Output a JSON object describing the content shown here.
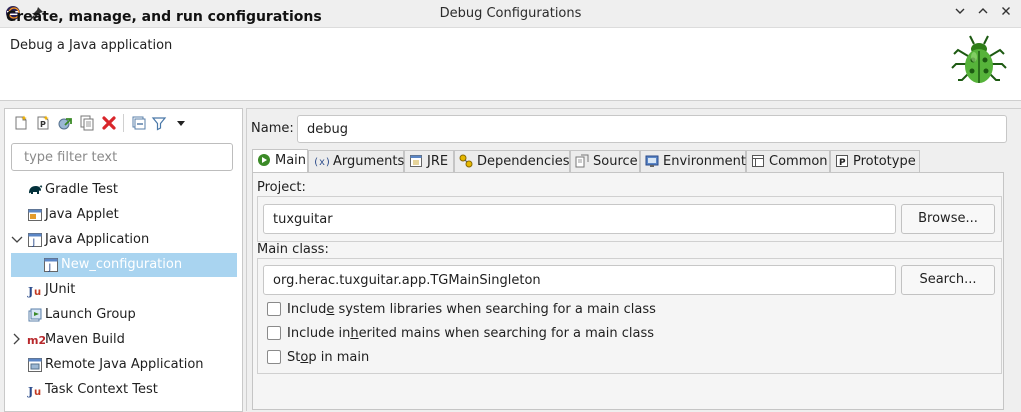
{
  "window": {
    "title": "Debug Configurations",
    "icons": [
      "eclipse-logo-icon",
      "pin-icon"
    ],
    "controls": [
      "minimize-icon",
      "maximize-icon",
      "close-icon"
    ]
  },
  "header": {
    "title": "Create, manage, and run configurations",
    "subtitle": "Debug a Java application",
    "logo": "debug-bug-icon"
  },
  "left_toolbar": {
    "icons": [
      "new-configuration-icon",
      "new-prototype-icon",
      "export-icon",
      "duplicate-icon",
      "delete-icon",
      "collapse-all-icon",
      "filter-icon",
      "view-menu-icon"
    ]
  },
  "filter": {
    "placeholder": "type filter text",
    "value": ""
  },
  "tree": {
    "items": [
      {
        "label": "Gradle Test",
        "icon": "gradle-icon"
      },
      {
        "label": "Java Applet",
        "icon": "java-applet-icon"
      },
      {
        "label": "Java Application",
        "icon": "java-application-icon",
        "expanded": true
      },
      {
        "label": "New_configuration",
        "icon": "java-application-icon",
        "selected": true
      },
      {
        "label": "JUnit",
        "icon": "junit-icon"
      },
      {
        "label": "Launch Group",
        "icon": "launch-group-icon"
      },
      {
        "label": "Maven Build",
        "icon": "maven-icon",
        "expanded": false
      },
      {
        "label": "Remote Java Application",
        "icon": "remote-java-icon"
      },
      {
        "label": "Task Context Test",
        "icon": "junit-icon"
      }
    ]
  },
  "config": {
    "name_label": "Name:",
    "name_value": "debug",
    "tabs": [
      {
        "label": "Main",
        "icon": "main-tab-icon",
        "active": true
      },
      {
        "label": "Arguments",
        "icon": "arguments-icon"
      },
      {
        "label": "JRE",
        "icon": "jre-icon"
      },
      {
        "label": "Dependencies",
        "icon": "dependencies-icon"
      },
      {
        "label": "Source",
        "icon": "source-icon"
      },
      {
        "label": "Environment",
        "icon": "environment-icon"
      },
      {
        "label": "Common",
        "icon": "common-icon"
      },
      {
        "label": "Prototype",
        "icon": "prototype-icon"
      }
    ],
    "project_label": "Project:",
    "project_value": "tuxguitar",
    "browse_button": "Browse...",
    "main_class_label": "Main class:",
    "main_class_value": "org.herac.tuxguitar.app.TGMainSingleton",
    "search_button": "Search...",
    "checkboxes": [
      {
        "pre": "Includ",
        "mnemonic": "e",
        "post": " system libraries when searching for a main class",
        "checked": false
      },
      {
        "pre": "Include in",
        "mnemonic": "h",
        "post": "erited mains when searching for a main class",
        "checked": false
      },
      {
        "pre": "St",
        "mnemonic": "o",
        "post": "p in main",
        "checked": false
      }
    ]
  },
  "colors": {
    "selection": "#a9d4f0",
    "window_bg": "#efefef",
    "delete_red": "#d9262b"
  }
}
